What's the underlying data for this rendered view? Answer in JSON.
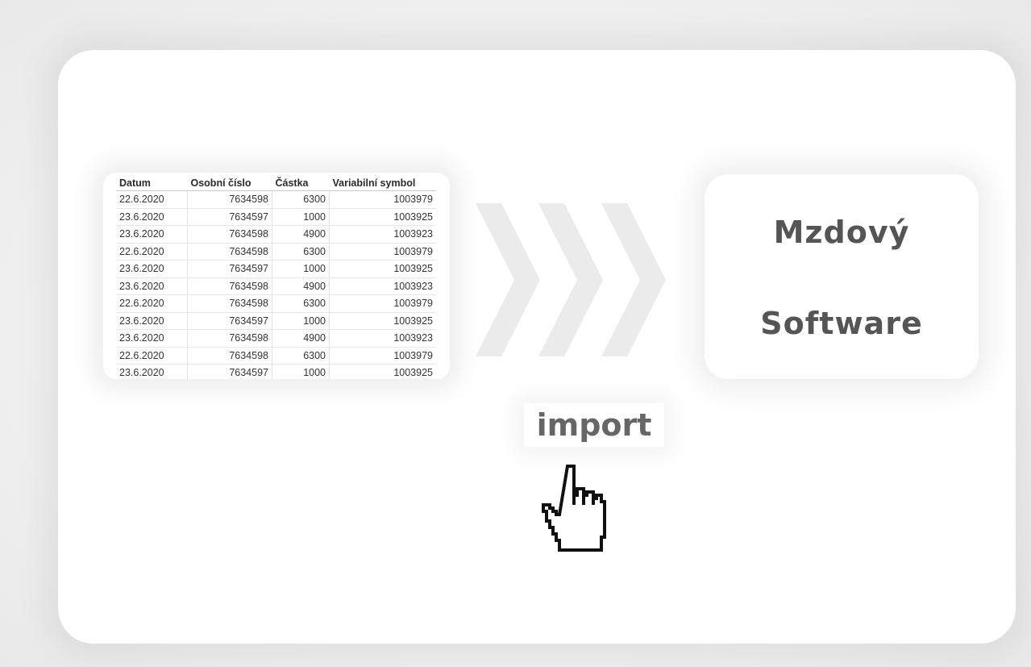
{
  "table": {
    "headers": [
      "Datum",
      "Osobní číslo",
      "Částka",
      "Variabilní symbol"
    ],
    "rows": [
      [
        "22.6.2020",
        "7634598",
        "6300",
        "1003979"
      ],
      [
        "23.6.2020",
        "7634597",
        "1000",
        "1003925"
      ],
      [
        "23.6.2020",
        "7634598",
        "4900",
        "1003923"
      ],
      [
        "22.6.2020",
        "7634598",
        "6300",
        "1003979"
      ],
      [
        "23.6.2020",
        "7634597",
        "1000",
        "1003925"
      ],
      [
        "23.6.2020",
        "7634598",
        "4900",
        "1003923"
      ],
      [
        "22.6.2020",
        "7634598",
        "6300",
        "1003979"
      ],
      [
        "23.6.2020",
        "7634597",
        "1000",
        "1003925"
      ],
      [
        "23.6.2020",
        "7634598",
        "4900",
        "1003923"
      ],
      [
        "22.6.2020",
        "7634598",
        "6300",
        "1003979"
      ],
      [
        "23.6.2020",
        "7634597",
        "1000",
        "1003925"
      ]
    ]
  },
  "software": {
    "line1": "Mzdový",
    "line2": "Software"
  },
  "import_label": "import",
  "icons": {
    "arrows": "triple-chevron-right-icon",
    "cursor": "hand-pointer-icon"
  },
  "colors": {
    "text": "#555555",
    "arrow": "#ebebeb",
    "background": "#ededed",
    "card": "#ffffff"
  }
}
